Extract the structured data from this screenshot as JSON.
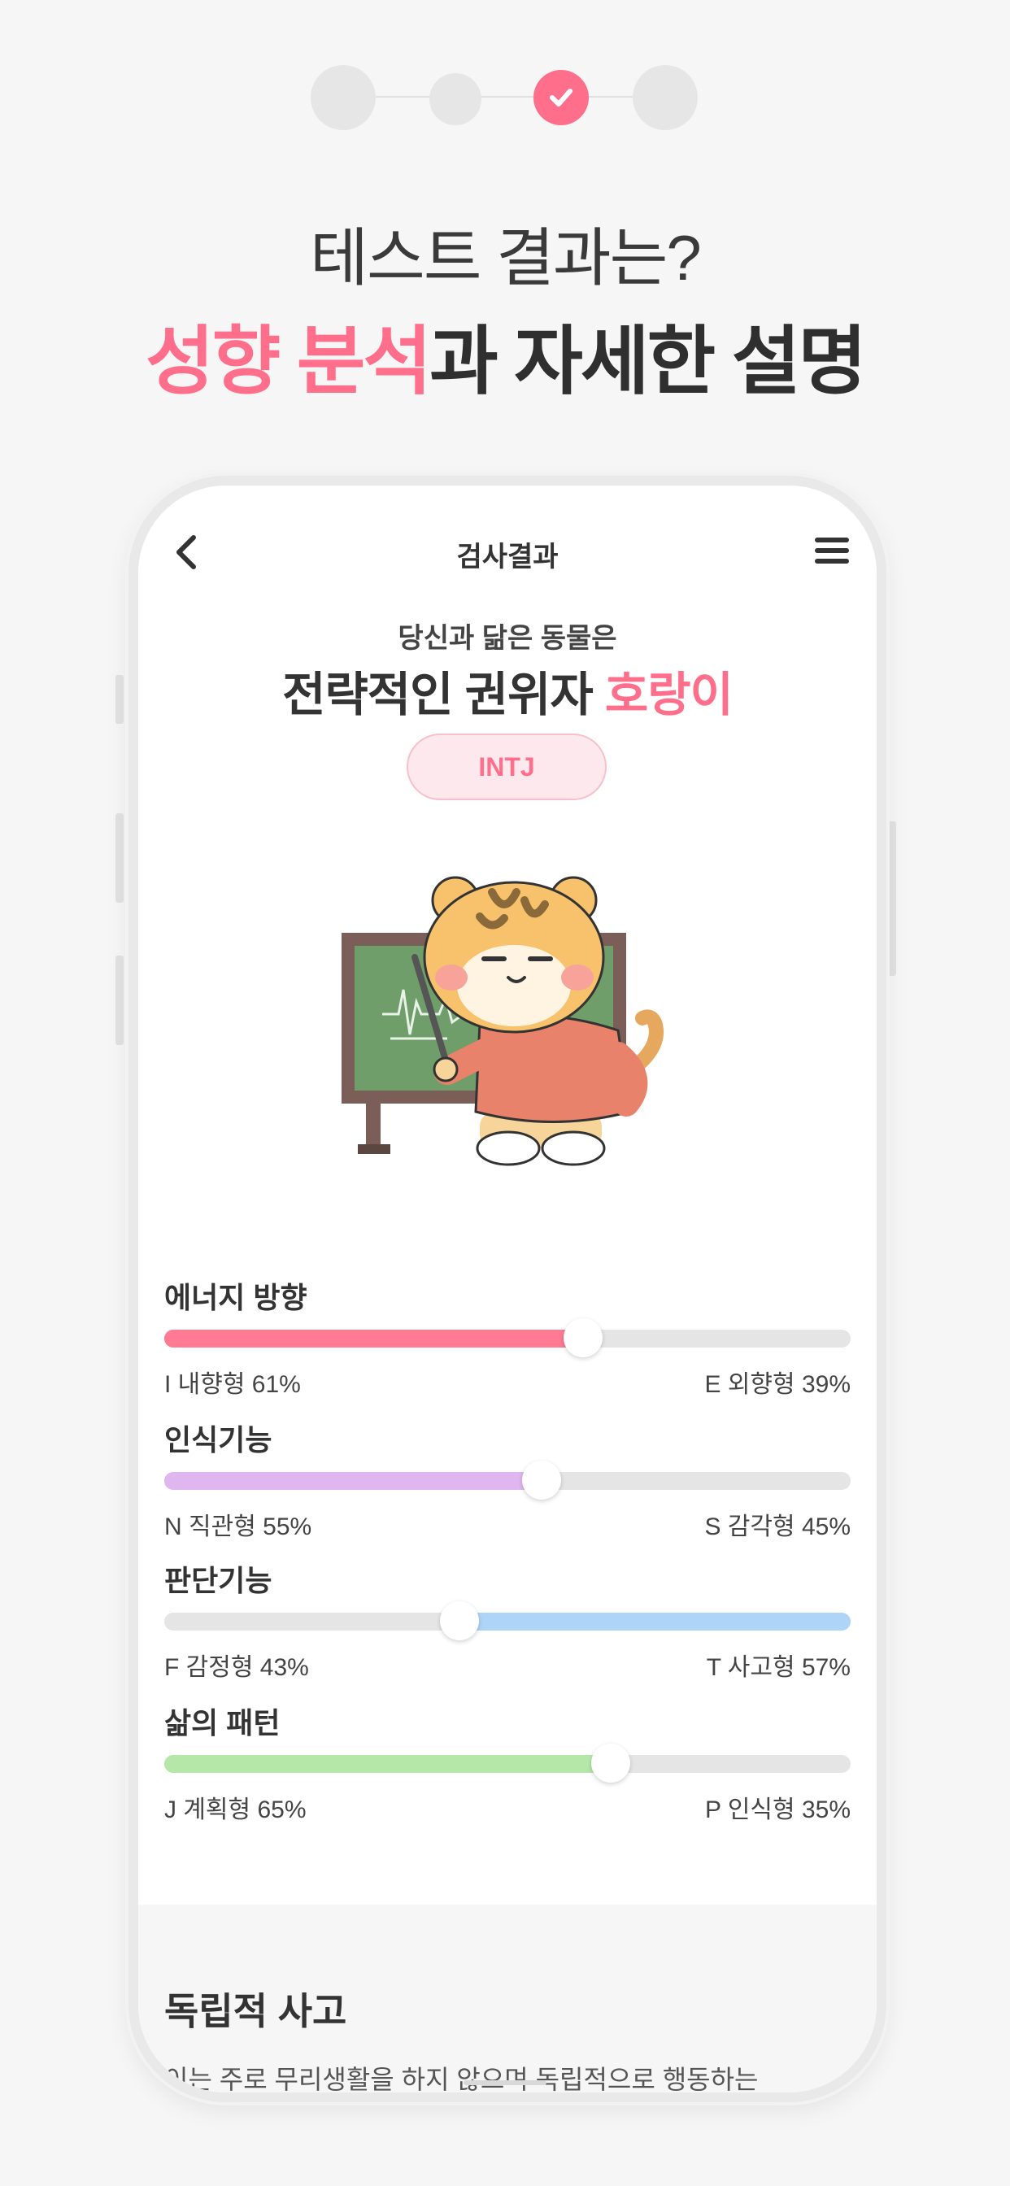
{
  "promo": {
    "headline_line1": "테스트 결과는?",
    "headline_line2_highlight": "성향 분석",
    "headline_line2_rest": "과 자세한 설명",
    "accent_color": "#ff6e8a"
  },
  "app": {
    "title": "검사결과",
    "back_icon": "chevron-left-icon",
    "menu_icon": "hamburger-menu-icon"
  },
  "result": {
    "subtitle": "당신과 닮은 동물은",
    "title_prefix": "전략적인 권위자 ",
    "animal": "호랑이",
    "type": "INTJ"
  },
  "traits": [
    {
      "name": "에너지 방향",
      "left_label": "I 내향형 61%",
      "right_label": "E 외향형 39%",
      "value": 61,
      "fill_side": "left",
      "color": "#ff7a92"
    },
    {
      "name": "인식기능",
      "left_label": "N 직관형 55%",
      "right_label": "S 감각형 45%",
      "value": 55,
      "fill_side": "left",
      "color": "#e0b6f0"
    },
    {
      "name": "판단기능",
      "left_label": "F 감정형 43%",
      "right_label": "T 사고형 57%",
      "value": 43,
      "fill_side": "right",
      "color": "#aed4f7"
    },
    {
      "name": "삶의 패턴",
      "left_label": "J 계획형 65%",
      "right_label": "P 인식형 35%",
      "value": 65,
      "fill_side": "left",
      "color": "#b5e7a8"
    }
  ],
  "section": {
    "title": "독립적 사고",
    "text": "이는 주로 무리생활을 하지 않으며 독립적으로 행동하는"
  }
}
